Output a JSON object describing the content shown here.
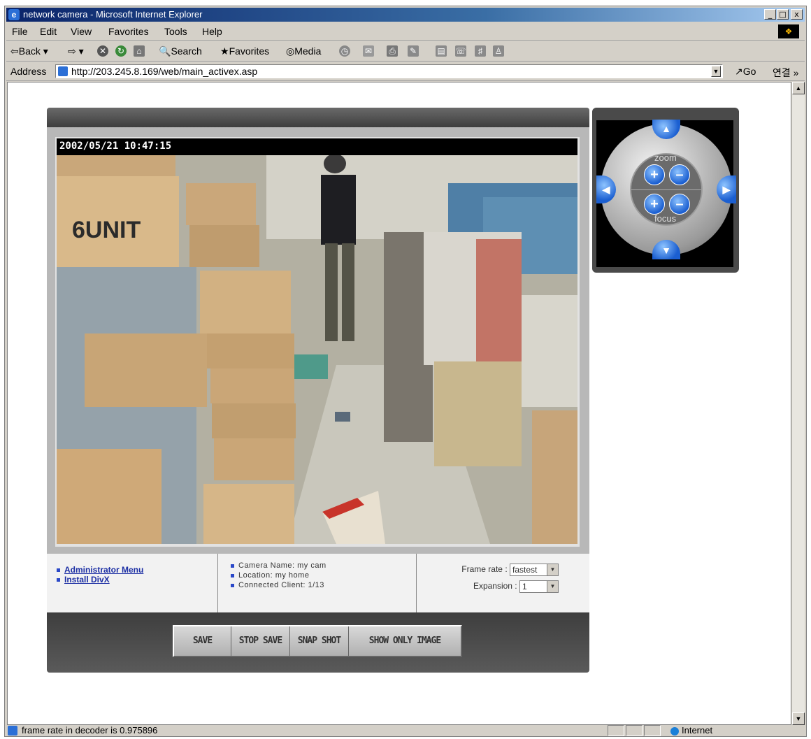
{
  "window": {
    "title": "network camera - Microsoft Internet Explorer",
    "minimize": "_",
    "maximize": "□",
    "close": "x"
  },
  "menu": [
    "File",
    "Edit",
    "View",
    "Favorites",
    "Tools",
    "Help"
  ],
  "toolbar": {
    "back": "Back",
    "search": "Search",
    "favorites": "Favorites",
    "media": "Media"
  },
  "address": {
    "label": "Address",
    "url": "http://203.245.8.169/web/main_activex.asp",
    "go": "Go",
    "links": "연결 »"
  },
  "camera": {
    "timestamp": "2002/05/21 10:47:15",
    "links": [
      "Administrator Menu",
      "Install DivX"
    ],
    "info": [
      "Camera Name: my cam",
      "Location: my home",
      "Connected Client: 1/13"
    ],
    "frame_rate_label": "Frame rate :",
    "frame_rate_value": "fastest",
    "expansion_label": "Expansion :",
    "expansion_value": "1",
    "buttons": [
      "SAVE",
      "STOP SAVE",
      "SNAP SHOT",
      "SHOW ONLY IMAGE"
    ]
  },
  "ptz": {
    "zoom_label": "zoom",
    "focus_label": "focus",
    "plus": "+",
    "minus": "–"
  },
  "status": {
    "text": "frame rate in decoder is 0.975896",
    "zone": "Internet"
  }
}
